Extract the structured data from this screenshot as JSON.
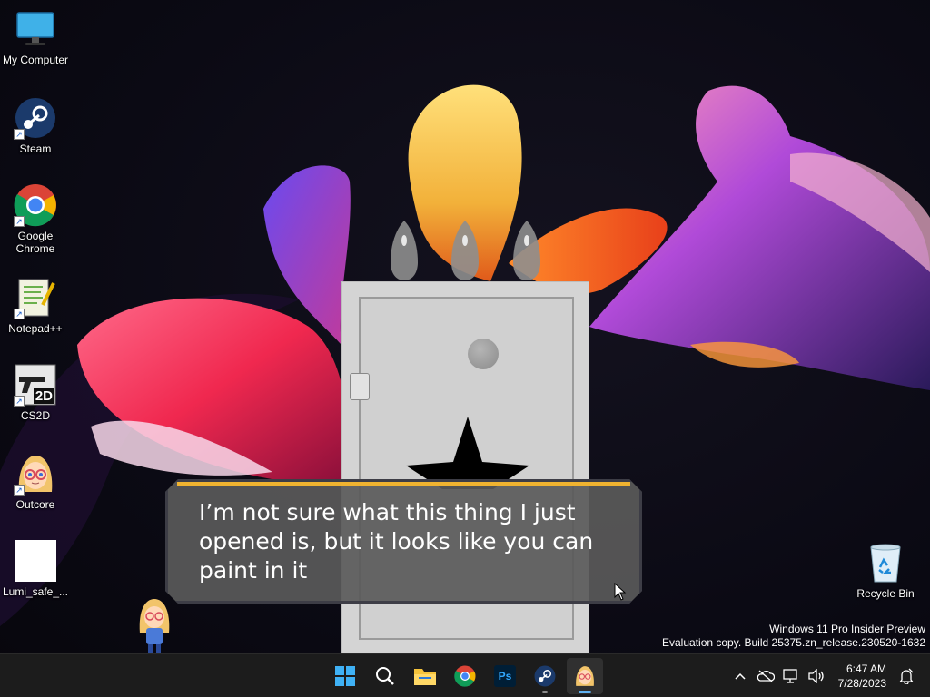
{
  "desktop": {
    "icons": [
      {
        "label": "My Computer"
      },
      {
        "label": "Steam"
      },
      {
        "label": "Google\nChrome"
      },
      {
        "label": "Notepad++"
      },
      {
        "label": "CS2D"
      },
      {
        "label": "Outcore"
      },
      {
        "label": "Lumi_safe_..."
      }
    ],
    "recycle_bin": {
      "label": "Recycle Bin"
    }
  },
  "game": {
    "dialog_text": "I’m not sure what this thing I just opened is, but it looks like you can paint in it",
    "accent_color": "#f0b330"
  },
  "watermark": {
    "line1": "Windows 11 Pro Insider Preview",
    "line2": "Evaluation copy. Build 25375.zn_release.230520-1632"
  },
  "taskbar": {
    "apps": [
      "start-icon",
      "search-icon",
      "file-explorer-icon",
      "chrome-icon",
      "photoshop-icon",
      "steam-icon",
      "outcore-icon"
    ],
    "photoshop_label": "Ps",
    "cs2d_label": "2D",
    "time": "6:47 AM",
    "date": "7/28/2023"
  }
}
